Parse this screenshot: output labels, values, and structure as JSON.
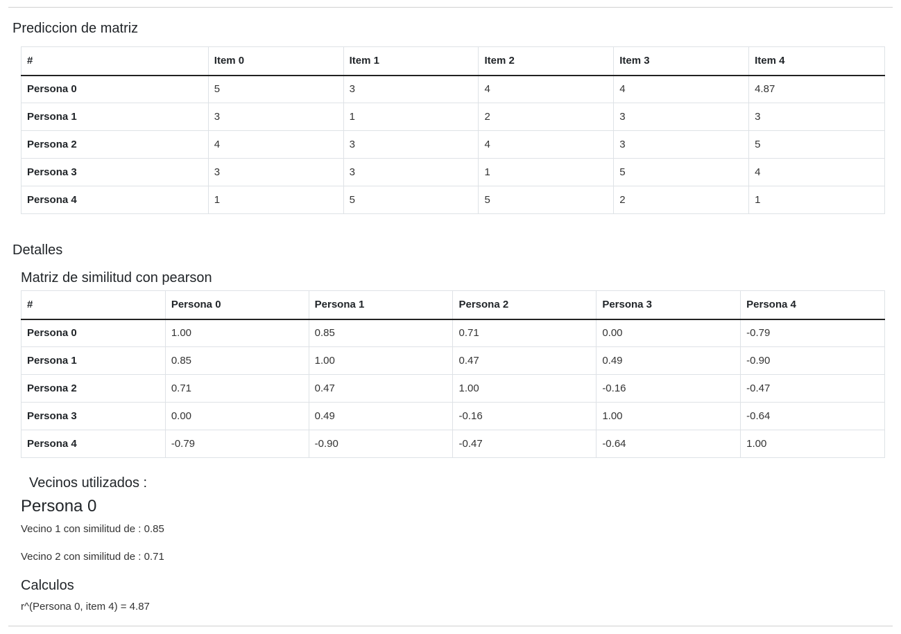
{
  "prediction": {
    "title": "Prediccion de matriz",
    "headers": [
      "#",
      "Item 0",
      "Item 1",
      "Item 2",
      "Item 3",
      "Item 4"
    ],
    "rows": [
      {
        "label": "Persona 0",
        "values": [
          "5",
          "3",
          "4",
          "4",
          "4.87"
        ]
      },
      {
        "label": "Persona 1",
        "values": [
          "3",
          "1",
          "2",
          "3",
          "3"
        ]
      },
      {
        "label": "Persona 2",
        "values": [
          "4",
          "3",
          "4",
          "3",
          "5"
        ]
      },
      {
        "label": "Persona 3",
        "values": [
          "3",
          "3",
          "1",
          "5",
          "4"
        ]
      },
      {
        "label": "Persona 4",
        "values": [
          "1",
          "5",
          "5",
          "2",
          "1"
        ]
      }
    ]
  },
  "details": {
    "title": "Detalles",
    "similarity": {
      "title": "Matriz de similitud con pearson",
      "headers": [
        "#",
        "Persona 0",
        "Persona 1",
        "Persona 2",
        "Persona 3",
        "Persona 4"
      ],
      "rows": [
        {
          "label": "Persona 0",
          "values": [
            "1.00",
            "0.85",
            "0.71",
            "0.00",
            "-0.79"
          ]
        },
        {
          "label": "Persona 1",
          "values": [
            "0.85",
            "1.00",
            "0.47",
            "0.49",
            "-0.90"
          ]
        },
        {
          "label": "Persona 2",
          "values": [
            "0.71",
            "0.47",
            "1.00",
            "-0.16",
            "-0.47"
          ]
        },
        {
          "label": "Persona 3",
          "values": [
            "0.00",
            "0.49",
            "-0.16",
            "1.00",
            "-0.64"
          ]
        },
        {
          "label": "Persona 4",
          "values": [
            "-0.79",
            "-0.90",
            "-0.47",
            "-0.64",
            "1.00"
          ]
        }
      ]
    },
    "neighbors": {
      "title": "Vecinos utilizados :",
      "person": "Persona 0",
      "items": [
        "Vecino 1 con similitud de : 0.85",
        "Vecino 2 con similitud de : 0.71"
      ]
    },
    "calculations": {
      "title": "Calculos",
      "formula": "r^(Persona 0, item 4) = 4.87"
    }
  }
}
